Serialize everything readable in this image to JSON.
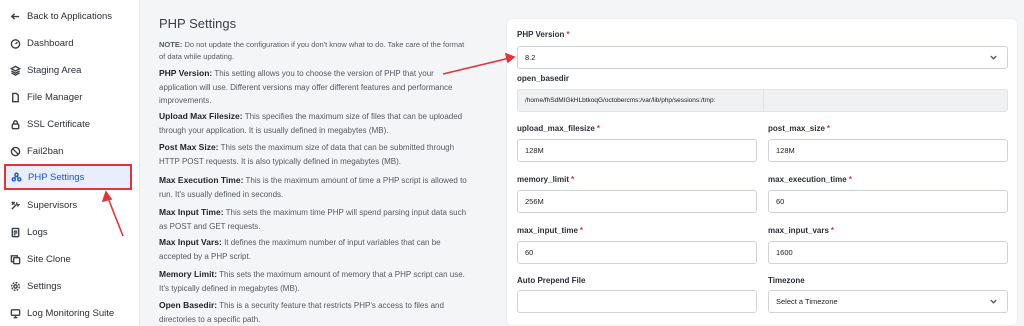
{
  "sidebar": {
    "items": [
      {
        "label": "Back to Applications",
        "icon": "arrow-left-icon",
        "name": "sidebar-item-back-to-applications"
      },
      {
        "label": "Dashboard",
        "icon": "dashboard-icon",
        "name": "sidebar-item-dashboard"
      },
      {
        "label": "Staging Area",
        "icon": "layers-icon",
        "name": "sidebar-item-staging-area"
      },
      {
        "label": "File Manager",
        "icon": "file-icon",
        "name": "sidebar-item-file-manager"
      },
      {
        "label": "SSL Certificate",
        "icon": "lock-icon",
        "name": "sidebar-item-ssl-certificate"
      },
      {
        "label": "Fail2ban",
        "icon": "ban-icon",
        "name": "sidebar-item-fail2ban"
      },
      {
        "label": "PHP Settings",
        "icon": "nodes-icon",
        "name": "sidebar-item-php-settings",
        "active": true
      },
      {
        "label": "Supervisors",
        "icon": "tools-icon",
        "name": "sidebar-item-supervisors"
      },
      {
        "label": "Logs",
        "icon": "document-icon",
        "name": "sidebar-item-logs"
      },
      {
        "label": "Site Clone",
        "icon": "copy-icon",
        "name": "sidebar-item-site-clone"
      },
      {
        "label": "Settings",
        "icon": "gear-icon",
        "name": "sidebar-item-settings"
      },
      {
        "label": "Log Monitoring Suite",
        "icon": "monitor-icon",
        "name": "sidebar-item-log-monitoring-suite"
      }
    ]
  },
  "content": {
    "title": "PHP Settings",
    "note_label": "NOTE:",
    "note_text": "Do not update the configuration if you don't know what to do. Take care of the format of data while updating.",
    "descriptions": [
      {
        "term": "PHP Version:",
        "text": "This setting allows you to choose the version of PHP that your application will use. Different versions may offer different features and performance improvements."
      },
      {
        "term": "Upload Max Filesize:",
        "text": "This specifies the maximum size of files that can be uploaded through your application. It is usually defined in megabytes (MB)."
      },
      {
        "term": "Post Max Size:",
        "text": "This sets the maximum size of data that can be submitted through HTTP POST requests. It is also typically defined in megabytes (MB)."
      },
      {
        "term": "Max Execution Time:",
        "text": "This is the maximum amount of time a PHP script is allowed to run. It's usually defined in seconds."
      },
      {
        "term": "Max Input Time:",
        "text": "This sets the maximum time PHP will spend parsing input data such as POST and GET requests."
      },
      {
        "term": "Max Input Vars:",
        "text": "It defines the maximum number of input variables that can be accepted by a PHP script."
      },
      {
        "term": "Memory Limit:",
        "text": "This sets the maximum amount of memory that a PHP script can use. It's typically defined in megabytes (MB)."
      },
      {
        "term": "Open Basedir:",
        "text": "This is a security feature that restricts PHP's access to files and directories to a specific path."
      }
    ]
  },
  "form": {
    "php_version": {
      "label": "PHP Version",
      "required": "*",
      "value": "8.2"
    },
    "open_basedir": {
      "label": "open_basedir",
      "value": "/home/fhSdMIGkHLbtkoqG/octobercms:/var/lib/php/sessions:/tmp:"
    },
    "upload_max_filesize": {
      "label": "upload_max_filesize",
      "required": "*",
      "value": "128M"
    },
    "post_max_size": {
      "label": "post_max_size",
      "required": "*",
      "value": "128M"
    },
    "memory_limit": {
      "label": "memory_limit",
      "required": "*",
      "value": "256M"
    },
    "max_execution_time": {
      "label": "max_execution_time",
      "required": "*",
      "value": "60"
    },
    "max_input_time": {
      "label": "max_input_time",
      "required": "*",
      "value": "60"
    },
    "max_input_vars": {
      "label": "max_input_vars",
      "required": "*",
      "value": "1600"
    },
    "auto_prepend_file": {
      "label": "Auto Prepend File",
      "value": ""
    },
    "timezone": {
      "label": "Timezone",
      "value": "Select a Timezone"
    }
  },
  "colors": {
    "accent": "#1d55d6",
    "highlight": "#e5323b",
    "active_bg": "#e9eefc"
  }
}
